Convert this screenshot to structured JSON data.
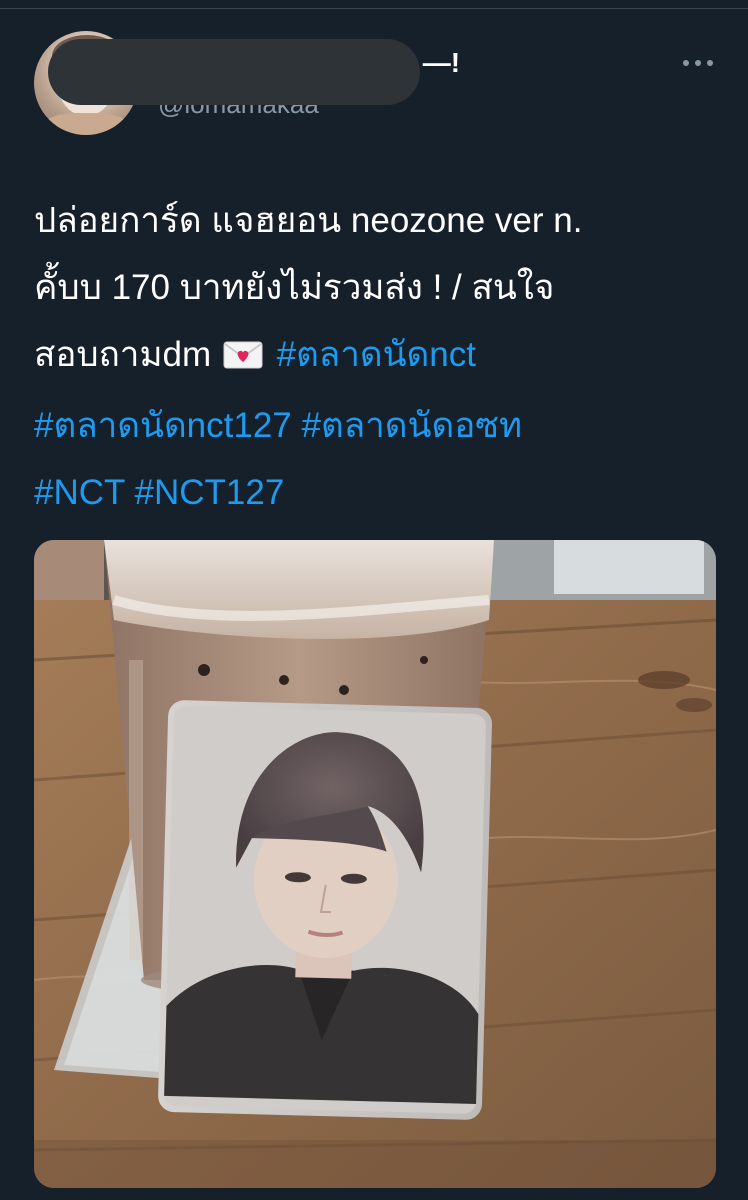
{
  "tweet": {
    "display_name_suffix": "—!",
    "handle": "@lomamakaa",
    "more_icon": "more-horizontal-icon",
    "text_lines": [
      "ปล่อยการ์ด แจฮยอน neozone ver n.",
      "คั้บบ 170 บาทยังไม่รวมส่ง ! / สนใจ"
    ],
    "line3_text": "สอบถามdm",
    "emoji": "love-letter-icon",
    "hashtags": {
      "h1": "#ตลาดนัดnct",
      "h2": "#ตลาดนัดnct127",
      "h3": "#ตลาดนัดอซท",
      "h4": "#NCT",
      "h5": "#NCT127"
    }
  },
  "colors": {
    "background": "#15202b",
    "text": "#ffffff",
    "secondary": "#8899a6",
    "link": "#1d9bf0",
    "redaction": "#2e3338"
  }
}
